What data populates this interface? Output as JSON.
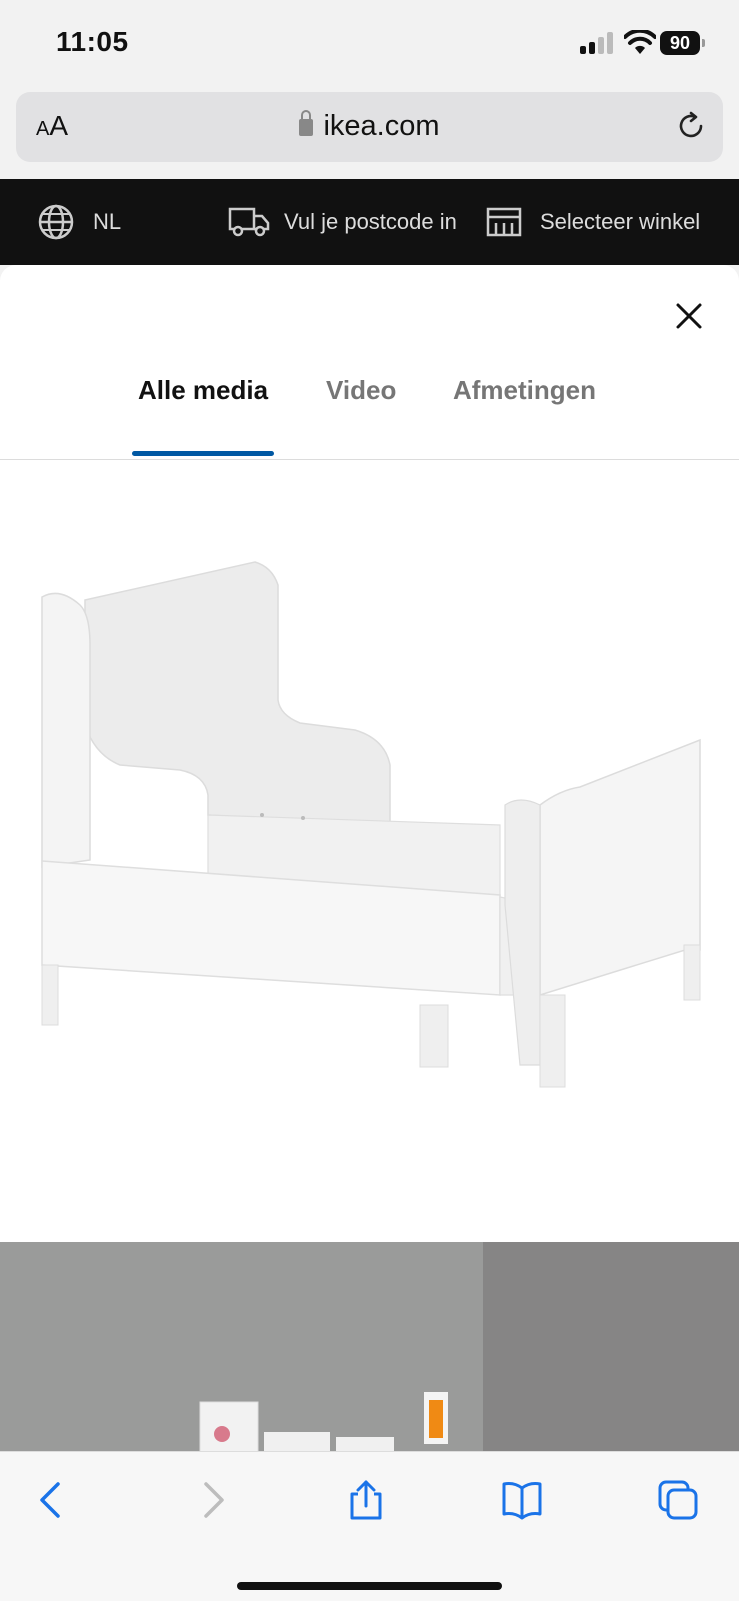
{
  "status_bar": {
    "time": "11:05",
    "battery": "90"
  },
  "browser": {
    "text_size_button": "AA",
    "url": "ikea.com"
  },
  "ikea_bar": {
    "language": "NL",
    "postcode_label": "Vul je postcode in",
    "store_label": "Selecteer winkel"
  },
  "modal": {
    "tabs": [
      {
        "label": "Alle media",
        "active": true
      },
      {
        "label": "Video",
        "active": false
      },
      {
        "label": "Afmetingen",
        "active": false
      }
    ]
  },
  "colors": {
    "accent": "#0058a3",
    "top_bar": "#111111"
  },
  "icons": [
    "signal-icon",
    "wifi-icon",
    "battery-icon",
    "lock-icon",
    "reload-icon",
    "globe-icon",
    "truck-icon",
    "store-icon",
    "close-icon",
    "back-icon",
    "forward-icon",
    "share-icon",
    "bookmarks-icon",
    "tabs-icon"
  ]
}
